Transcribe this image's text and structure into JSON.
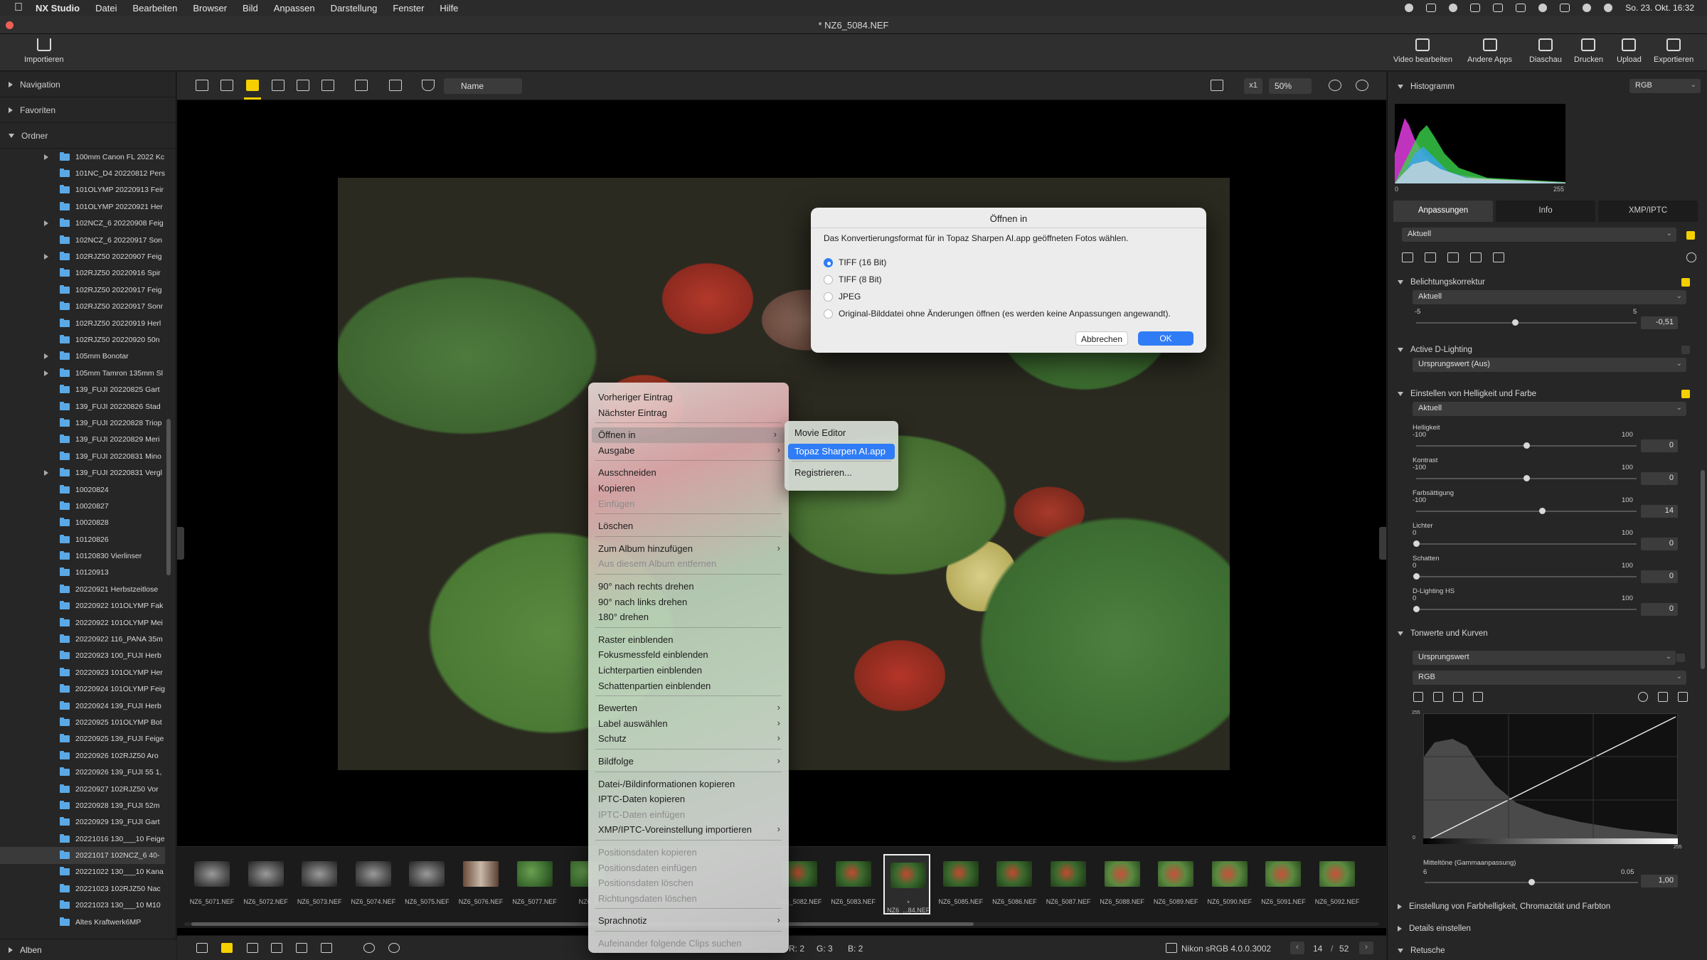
{
  "menubar": {
    "app": "NX Studio",
    "items": [
      "Datei",
      "Bearbeiten",
      "Browser",
      "Bild",
      "Anpassen",
      "Darstellung",
      "Fenster",
      "Hilfe"
    ],
    "clock": "So. 23. Okt. 16:32"
  },
  "window": {
    "title": "* NZ6_5084.NEF"
  },
  "toolbar": {
    "import_label": "Importieren",
    "right_buttons": [
      "Video bearbeiten",
      "Andere Apps",
      "Diaschau",
      "Drucken",
      "Upload",
      "Exportieren"
    ]
  },
  "left_panel": {
    "navigation": "Navigation",
    "favorites": "Favoriten",
    "folders": "Ordner",
    "albums": "Alben",
    "folder_items": [
      {
        "name": "100mm Canon FL 2022 Kc",
        "expandable": true
      },
      {
        "name": "101NC_D4 20220812 Pers",
        "expandable": false
      },
      {
        "name": "101OLYMP 20220913 Feir",
        "expandable": false
      },
      {
        "name": "101OLYMP 20220921 Her",
        "expandable": false
      },
      {
        "name": "102NCZ_6 20220908 Feig",
        "expandable": true
      },
      {
        "name": "102NCZ_6 20220917 Son",
        "expandable": false
      },
      {
        "name": "102RJZ50 20220907 Feig",
        "expandable": true
      },
      {
        "name": "102RJZ50 20220916 Spir",
        "expandable": false
      },
      {
        "name": "102RJZ50 20220917 Feig",
        "expandable": false
      },
      {
        "name": "102RJZ50 20220917 Sonr",
        "expandable": false
      },
      {
        "name": "102RJZ50 20220919 Herl",
        "expandable": false
      },
      {
        "name": "102RJZ50 20220920 50n",
        "expandable": false
      },
      {
        "name": "105mm Bonotar",
        "expandable": true
      },
      {
        "name": "105mm Tamron 135mm Sl",
        "expandable": true
      },
      {
        "name": "139_FUJI 20220825 Gart",
        "expandable": false
      },
      {
        "name": "139_FUJI 20220826 Stad",
        "expandable": false
      },
      {
        "name": "139_FUJI 20220828 Triop",
        "expandable": false
      },
      {
        "name": "139_FUJI 20220829 Meri",
        "expandable": false
      },
      {
        "name": "139_FUJI 20220831 Mino",
        "expandable": false
      },
      {
        "name": "139_FUJI 20220831 Vergl",
        "expandable": true
      },
      {
        "name": "10020824",
        "expandable": false
      },
      {
        "name": "10020827",
        "expandable": false
      },
      {
        "name": "10020828",
        "expandable": false
      },
      {
        "name": "10120826",
        "expandable": false
      },
      {
        "name": "10120830 Vierlinser",
        "expandable": false
      },
      {
        "name": "10120913",
        "expandable": false
      },
      {
        "name": "20220921 Herbstzeitlose",
        "expandable": false
      },
      {
        "name": "20220922 101OLYMP Fak",
        "expandable": false
      },
      {
        "name": "20220922 101OLYMP Mei",
        "expandable": false
      },
      {
        "name": "20220922 116_PANA 35m",
        "expandable": false
      },
      {
        "name": "20220923 100_FUJI Herb",
        "expandable": false
      },
      {
        "name": "20220923 101OLYMP Her",
        "expandable": false
      },
      {
        "name": "20220924 101OLYMP Feig",
        "expandable": false
      },
      {
        "name": "20220924 139_FUJI Herb",
        "expandable": false
      },
      {
        "name": "20220925 101OLYMP Bot",
        "expandable": false
      },
      {
        "name": "20220925 139_FUJI Feige",
        "expandable": false
      },
      {
        "name": "20220926 102RJZ50 Aro",
        "expandable": false
      },
      {
        "name": "20220926 139_FUJI 55 1,",
        "expandable": false
      },
      {
        "name": "20220927 102RJZ50 Vor",
        "expandable": false
      },
      {
        "name": "20220928 139_FUJI 52m",
        "expandable": false
      },
      {
        "name": "20220929 139_FUJI Gart",
        "expandable": false
      },
      {
        "name": "20221016 130___10 Feige",
        "expandable": false
      },
      {
        "name": "20221017 102NCZ_6 40-",
        "expandable": false,
        "selected": true
      },
      {
        "name": "20221022 130___10 Kana",
        "expandable": false
      },
      {
        "name": "20221023 102RJZ50 Nac",
        "expandable": false
      },
      {
        "name": "20221023 130___10 M10",
        "expandable": false
      },
      {
        "name": "Altes Kraftwerk6MP",
        "expandable": false
      }
    ]
  },
  "viewbar": {
    "sort": "Name",
    "zoom_factor": "x1",
    "zoom": "50%"
  },
  "filmstrip": {
    "thumbnails": [
      "NZ6_5071.NEF",
      "NZ6_5072.NEF",
      "NZ6_5073.NEF",
      "NZ6_5074.NEF",
      "NZ6_5075.NEF",
      "NZ6_5076.NEF",
      "NZ6_5077.NEF",
      "NZ6_5",
      "NZ6_5082.NEF",
      "NZ6_5083.NEF",
      "* NZ6_...84.NEF",
      "NZ6_5085.NEF",
      "NZ6_5086.NEF",
      "NZ6_5087.NEF",
      "NZ6_5088.NEF",
      "NZ6_5089.NEF",
      "NZ6_5090.NEF",
      "NZ6_5091.NEF",
      "NZ6_5092.NEF"
    ],
    "selected_index": 10
  },
  "statusbar": {
    "rgb_g": "G: 3",
    "rgb_b": "B: 2",
    "rgb_r": "R: 2",
    "color_profile": "Nikon sRGB 4.0.0.3002",
    "page_current": "14",
    "page_total": "52"
  },
  "dialog": {
    "title": "Öffnen in",
    "message": "Das Konvertierungsformat für in Topaz Sharpen AI.app geöffneten Fotos wählen.",
    "options": [
      "TIFF (16 Bit)",
      "TIFF (8 Bit)",
      "JPEG",
      "Original-Bilddatei ohne Änderungen öffnen (es werden keine Anpassungen angewandt)."
    ],
    "selected_option": 0,
    "cancel_label": "Abbrechen",
    "ok_label": "OK"
  },
  "context_menu": {
    "items": [
      {
        "label": "Vorheriger Eintrag"
      },
      {
        "label": "Nächster Eintrag"
      },
      {
        "label": "Öffnen in",
        "submenu": true,
        "highlight": true
      },
      {
        "label": "Ausgabe",
        "submenu": true
      },
      {
        "label": "Ausschneiden"
      },
      {
        "label": "Kopieren"
      },
      {
        "label": "Einfügen",
        "disabled": true
      },
      {
        "label": "Löschen"
      },
      {
        "label": "Zum Album hinzufügen",
        "submenu": true
      },
      {
        "label": "Aus diesem Album entfernen",
        "disabled": true
      },
      {
        "label": "90° nach rechts drehen"
      },
      {
        "label": "90° nach links drehen"
      },
      {
        "label": "180° drehen"
      },
      {
        "label": "Raster einblenden"
      },
      {
        "label": "Fokusmessfeld einblenden"
      },
      {
        "label": "Lichterpartien einblenden"
      },
      {
        "label": "Schattenpartien einblenden"
      },
      {
        "label": "Bewerten",
        "submenu": true
      },
      {
        "label": "Label auswählen",
        "submenu": true
      },
      {
        "label": "Schutz",
        "submenu": true
      },
      {
        "label": "Bildfolge",
        "submenu": true
      },
      {
        "label": "Datei-/Bildinformationen kopieren"
      },
      {
        "label": "IPTC-Daten kopieren"
      },
      {
        "label": "IPTC-Daten einfügen",
        "disabled": true
      },
      {
        "label": "XMP/IPTC-Voreinstellung importieren",
        "submenu": true
      },
      {
        "label": "Positionsdaten kopieren",
        "disabled": true
      },
      {
        "label": "Positionsdaten einfügen",
        "disabled": true
      },
      {
        "label": "Positionsdaten löschen",
        "disabled": true
      },
      {
        "label": "Richtungsdaten löschen",
        "disabled": true
      },
      {
        "label": "Sprachnotiz",
        "submenu": true
      },
      {
        "label": "Aufeinander folgende Clips suchen",
        "disabled": true
      }
    ]
  },
  "submenu": {
    "items": [
      "Movie Editor",
      "Topaz Sharpen AI.app",
      "Registrieren..."
    ],
    "highlight_index": 1
  },
  "right_panel": {
    "histogram_title": "Histogramm",
    "histogram_channel": "RGB",
    "hist_min": "0",
    "hist_max": "255",
    "tabs": [
      "Anpassungen",
      "Info",
      "XMP/IPTC"
    ],
    "preset": "Aktuell",
    "exposure": {
      "title": "Belichtungskorrektur",
      "preset": "Aktuell",
      "min": "-5",
      "max": "5",
      "value": "-0,51",
      "level": -0.51
    },
    "adl": {
      "title": "Active D-Lighting",
      "preset": "Ursprungswert (Aus)"
    },
    "brightness_color": {
      "title": "Einstellen von Helligkeit und Farbe",
      "preset": "Aktuell",
      "sliders": [
        {
          "label": "Helligkeit",
          "min": "-100",
          "max": "100",
          "value": "0",
          "level": 0
        },
        {
          "label": "Kontrast",
          "min": "-100",
          "max": "100",
          "value": "0",
          "level": 0
        },
        {
          "label": "Farbsättigung",
          "min": "-100",
          "max": "100",
          "value": "14",
          "level": 14
        },
        {
          "label": "Lichter",
          "min": "0",
          "max": "100",
          "value": "0",
          "level": 0
        },
        {
          "label": "Schatten",
          "min": "0",
          "max": "100",
          "value": "0",
          "level": 0
        },
        {
          "label": "D-Lighting HS",
          "min": "0",
          "max": "100",
          "value": "0",
          "level": 0
        }
      ]
    },
    "curves": {
      "title": "Tonwerte und Kurven",
      "preset": "Ursprungswert",
      "channel": "RGB",
      "curve_top": "255",
      "curve_bottom": "0",
      "curve_bottom_right": "255",
      "midtone_label": "Mitteltöne (Gammaanpassung)",
      "midtone_min": "6",
      "midtone_max": "0.05",
      "midtone_value": "1,00"
    },
    "collapsed_sections": [
      "Einstellung von Farbhelligkeit, Chromazität und Farbton",
      "Details einstellen",
      "Retusche"
    ]
  }
}
